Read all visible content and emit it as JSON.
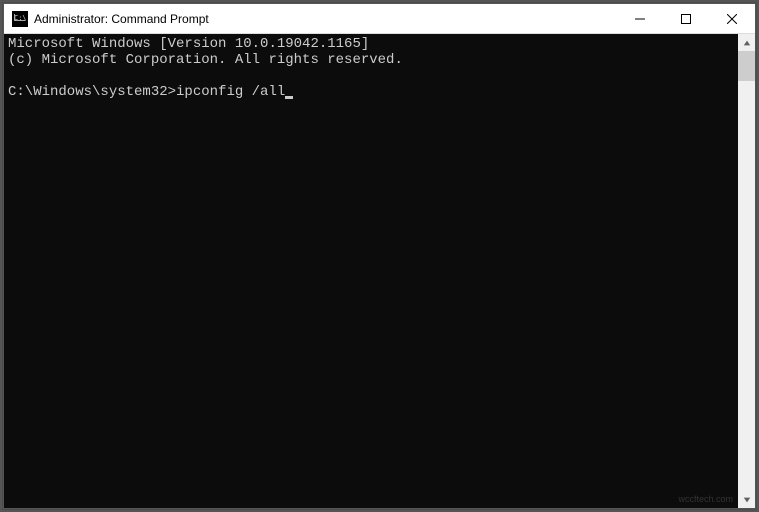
{
  "window": {
    "title": "Administrator: Command Prompt"
  },
  "terminal": {
    "line1": "Microsoft Windows [Version 10.0.19042.1165]",
    "line2": "(c) Microsoft Corporation. All rights reserved.",
    "blank": "",
    "prompt": "C:\\Windows\\system32>",
    "command": "ipconfig /all"
  },
  "watermark": "wccftech.com"
}
